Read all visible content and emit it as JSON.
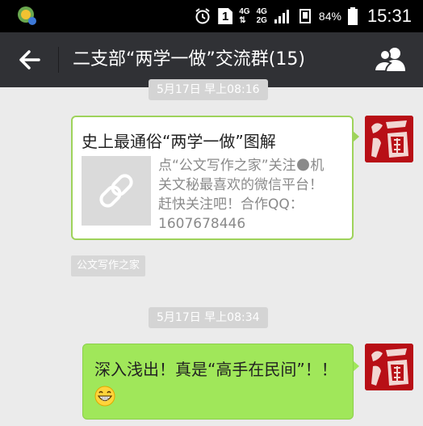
{
  "status_bar": {
    "network_top": "4G",
    "network_bottom": "2G",
    "network_top2": "4G",
    "sim_label": "1",
    "battery": "84%",
    "time": "15:31",
    "icons": [
      "app-notification-icon",
      "alarm-icon",
      "sim-icon",
      "signal-icon",
      "vibrate-icon",
      "battery-icon"
    ]
  },
  "header": {
    "title": "二支部“两学一做”交流群(15)",
    "back_icon": "arrow-left-icon",
    "members_icon": "group-members-icon"
  },
  "messages": [
    {
      "time": "5月17日 早上08:16",
      "type": "link-card",
      "title": "史上最通俗“两学一做”图解",
      "thumb_icon": "link-icon",
      "description": "点“公文写作之家”关注🌑机关文秘最喜欢的微信平台！赶快关注吧！合作QQ：1607678446",
      "source": "公文写作之家"
    },
    {
      "time": "5月17日 早上08:34",
      "type": "text",
      "text": "深入浅出！真是“高手在民间”！！",
      "emoji": "grinning-face-icon"
    }
  ],
  "colors": {
    "header_bg": "#303135",
    "chat_bg": "#ebebeb",
    "bubble_green": "#a0e75a",
    "card_border": "#9ed35b",
    "avatar_red": "#b80f16"
  }
}
